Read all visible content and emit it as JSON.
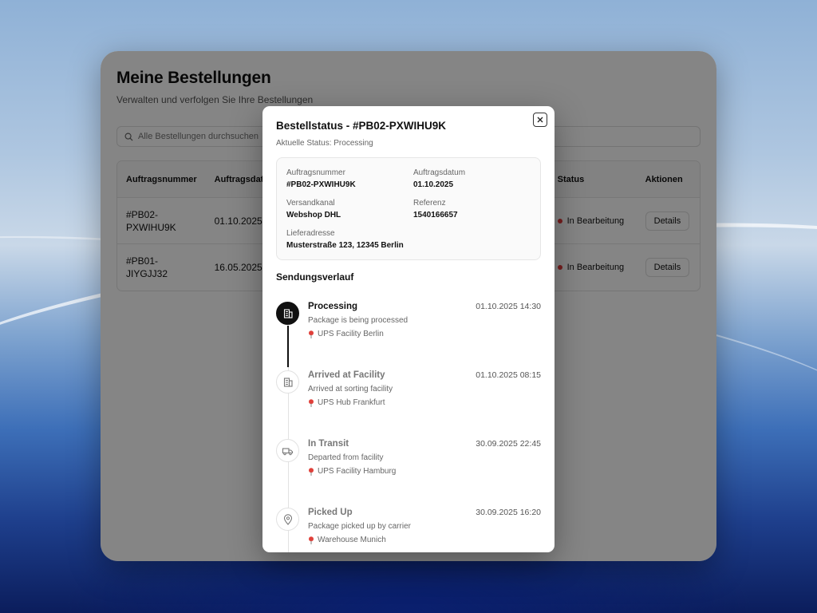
{
  "page": {
    "title": "Meine Bestellungen",
    "subtitle": "Verwalten und verfolgen Sie Ihre Bestellungen",
    "search_placeholder": "Alle Bestellungen durchsuchen"
  },
  "table": {
    "headers": {
      "order_no": "Auftragsnummer",
      "order_date": "Auftragsdatum",
      "status": "Status",
      "actions": "Aktionen"
    },
    "rows": [
      {
        "order_no": "#PB02-PXWIHU9K",
        "date": "01.10.2025",
        "status": "In Bearbeitung",
        "action": "Details"
      },
      {
        "order_no": "#PB01-JIYGJJ32",
        "date": "16.05.2025",
        "status": "In Bearbeitung",
        "action": "Details"
      }
    ]
  },
  "modal": {
    "title": "Bestellstatus - #PB02-PXWIHU9K",
    "subtitle": "Aktuelle Status: Processing",
    "info": {
      "order_no_label": "Auftragsnummer",
      "order_no": "#PB02-PXWIHU9K",
      "order_date_label": "Auftragsdatum",
      "order_date": "01.10.2025",
      "channel_label": "Versandkanal",
      "channel": "Webshop DHL",
      "reference_label": "Referenz",
      "reference": "1540166657",
      "address_label": "Lieferadresse",
      "address": "Musterstraße 123, 12345 Berlin"
    },
    "history_title": "Sendungsverlauf",
    "timeline": [
      {
        "title": "Processing",
        "time": "01.10.2025 14:30",
        "desc": "Package is being processed",
        "location": "UPS Facility Berlin",
        "icon": "building-icon"
      },
      {
        "title": "Arrived at Facility",
        "time": "01.10.2025 08:15",
        "desc": "Arrived at sorting facility",
        "location": "UPS Hub Frankfurt",
        "icon": "building-icon"
      },
      {
        "title": "In Transit",
        "time": "30.09.2025 22:45",
        "desc": "Departed from facility",
        "location": "UPS Facility Hamburg",
        "icon": "truck-icon"
      },
      {
        "title": "Picked Up",
        "time": "30.09.2025 16:20",
        "desc": "Package picked up by carrier",
        "location": "Warehouse Munich",
        "icon": "map-pin-icon"
      }
    ]
  },
  "colors": {
    "status_dot": "#e23b3b",
    "accent_dark": "#111111",
    "pin": "#e0403a"
  }
}
